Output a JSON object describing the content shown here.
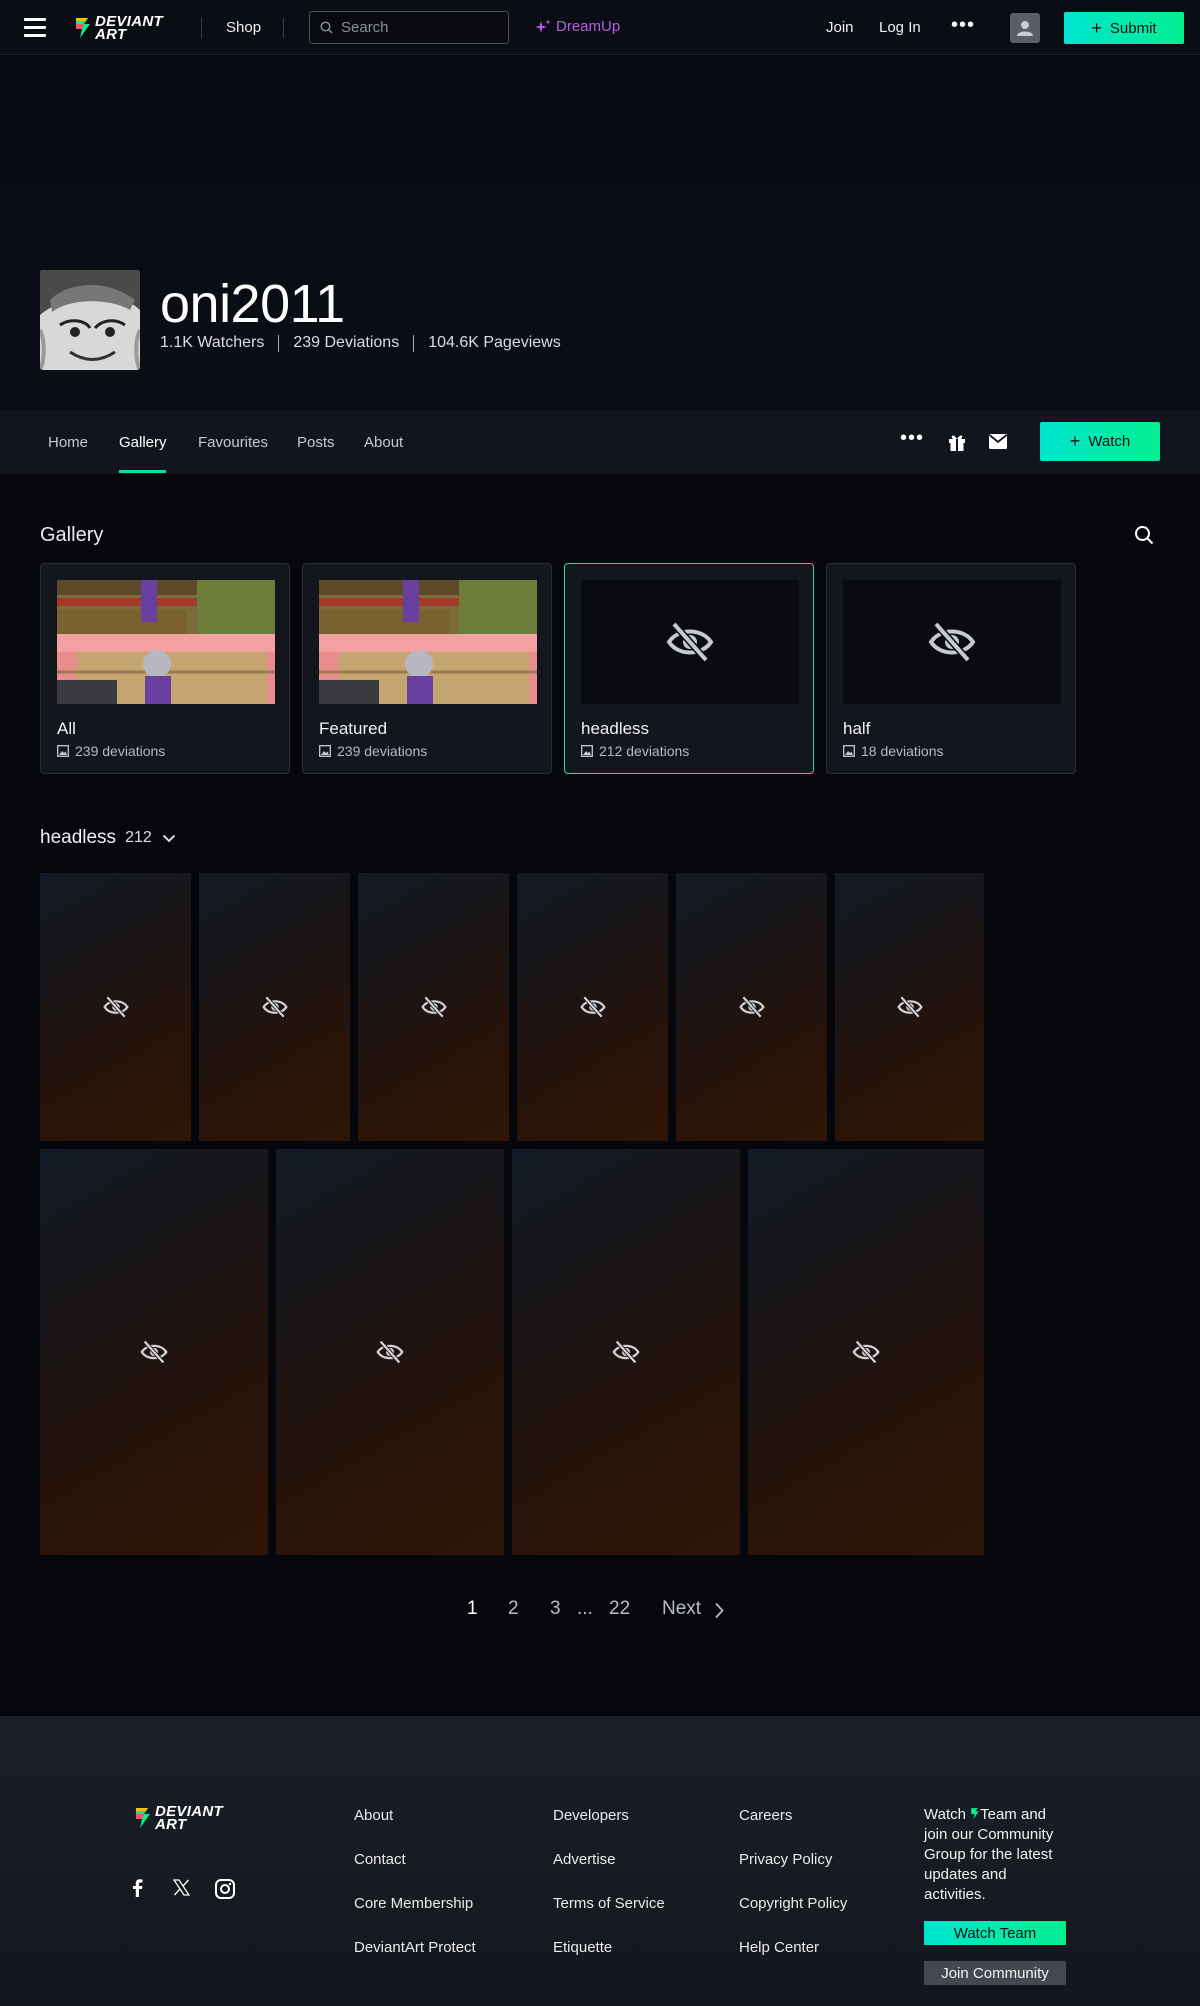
{
  "header": {
    "logo_text_line1": "DEVIANT",
    "logo_text_line2": "ART",
    "shop_label": "Shop",
    "search_placeholder": "Search",
    "dreamup_label": "DreamUp",
    "join_label": "Join",
    "login_label": "Log In",
    "more_label": "•••",
    "submit_label": "Submit",
    "accent_color": "#05ee90",
    "dreamup_color": "#b35fe6"
  },
  "profile": {
    "username": "oni2011",
    "watchers": "1.1K Watchers",
    "deviations": "239 Deviations",
    "pageviews": "104.6K Pageviews"
  },
  "profile_nav": {
    "tabs": [
      {
        "label": "Home"
      },
      {
        "label": "Gallery"
      },
      {
        "label": "Favourites"
      },
      {
        "label": "Posts"
      },
      {
        "label": "About"
      }
    ],
    "active_tab": "Gallery",
    "more_label": "•••",
    "watch_label": "Watch"
  },
  "gallery": {
    "title": "Gallery",
    "folders": [
      {
        "name": "All",
        "count": "239 deviations",
        "thumb": "image"
      },
      {
        "name": "Featured",
        "count": "239 deviations",
        "thumb": "image"
      },
      {
        "name": "headless",
        "count": "212 deviations",
        "thumb": "hidden-eye-icon",
        "selected": true
      },
      {
        "name": "half",
        "count": "18 deviations",
        "thumb": "hidden-eye-icon"
      }
    ],
    "section_name": "headless",
    "section_count": "212"
  },
  "pagination": {
    "pages": [
      "1",
      "2",
      "3"
    ],
    "ellipsis": "...",
    "last_page": "22",
    "next_label": "Next",
    "current": "1"
  },
  "footer": {
    "logo_text_line1": "DEVIANT",
    "logo_text_line2": "ART",
    "col1": [
      "About",
      "Contact",
      "Core Membership",
      "DeviantArt Protect"
    ],
    "col2": [
      "Developers",
      "Advertise",
      "Terms of Service",
      "Etiquette"
    ],
    "col3": [
      "Careers",
      "Privacy Policy",
      "Copyright Policy",
      "Help Center"
    ],
    "community_text_before": "Watch",
    "community_text_after": "Team and join our Community Group for the latest updates and activities.",
    "watch_team_label": "Watch Team",
    "join_community_label": "Join Community",
    "social_icons": [
      "facebook-icon",
      "x-icon",
      "instagram-icon"
    ]
  }
}
